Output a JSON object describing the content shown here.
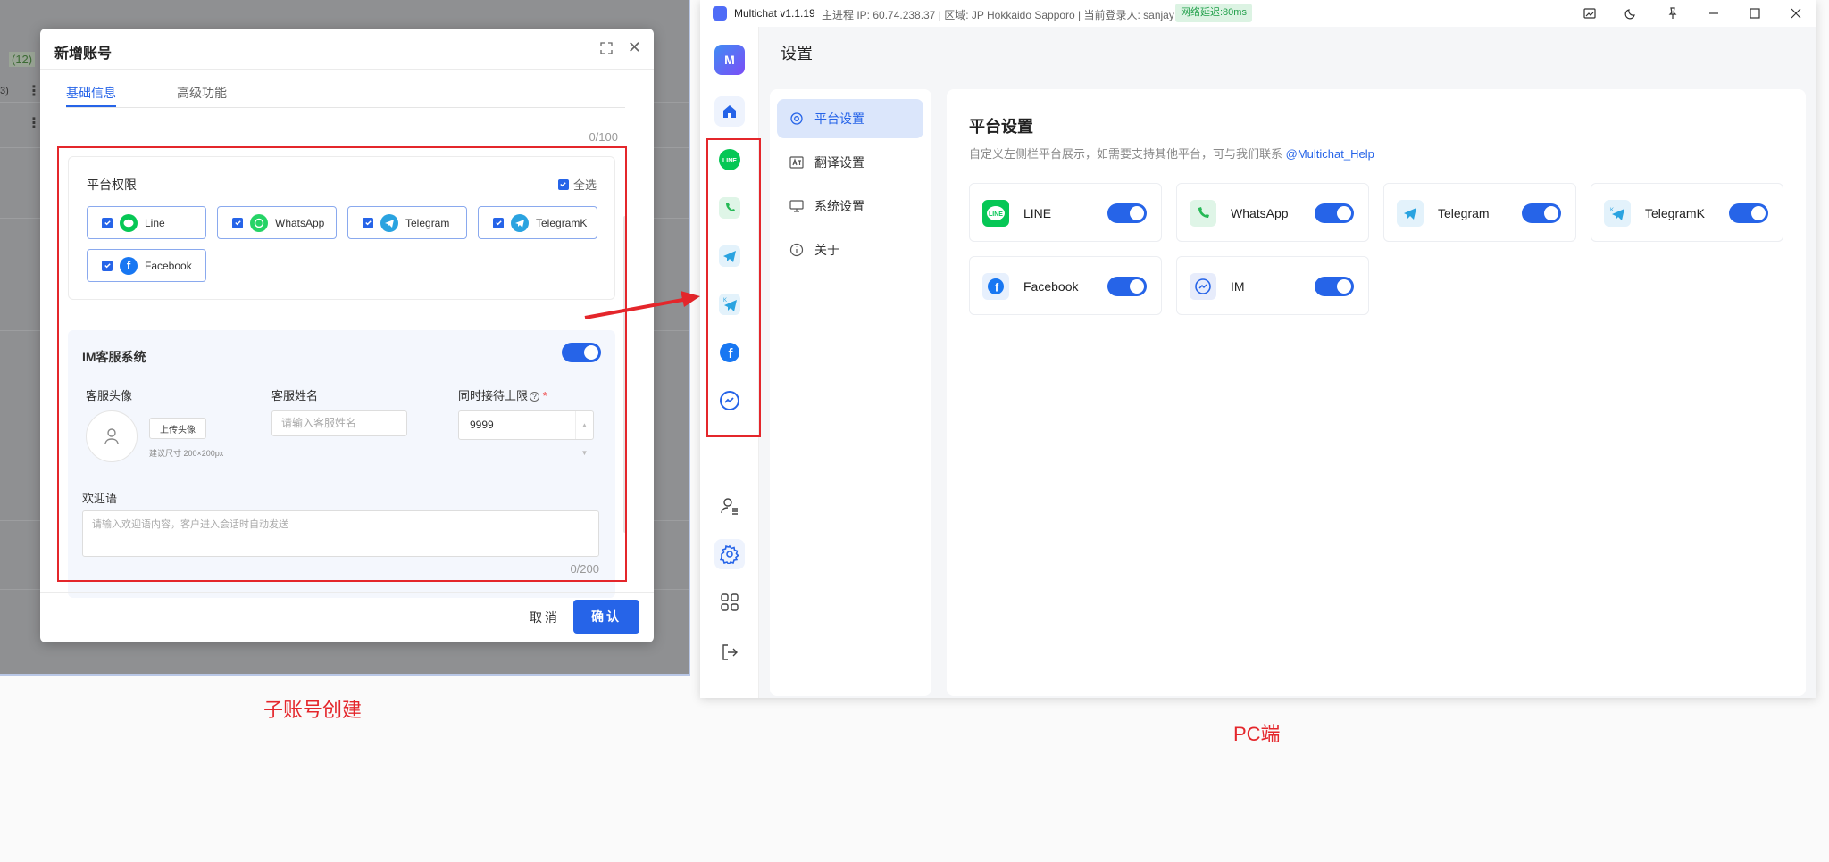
{
  "left": {
    "background": {
      "badge": "(12)",
      "small": "3)"
    },
    "modal": {
      "title": "新增账号",
      "tabs": [
        "基础信息",
        "高级功能"
      ],
      "counter_top": "0/100",
      "permissions": {
        "title": "平台权限",
        "select_all": "全选",
        "platforms": [
          {
            "label": "Line",
            "icon": "line-icon",
            "color": "#06c755"
          },
          {
            "label": "WhatsApp",
            "icon": "whatsapp-icon",
            "color": "#25d366"
          },
          {
            "label": "Telegram",
            "icon": "telegram-icon",
            "color": "#2aa3e0"
          },
          {
            "label": "TelegramK",
            "icon": "telegramk-icon",
            "color": "#2aa3e0"
          },
          {
            "label": "Facebook",
            "icon": "facebook-icon",
            "color": "#1877f2"
          }
        ]
      },
      "im": {
        "title": "IM客服系统",
        "avatar_label": "客服头像",
        "upload_button": "上传头像",
        "upload_hint": "建议尺寸 200×200px",
        "name_label": "客服姓名",
        "name_placeholder": "请输入客服姓名",
        "limit_label": "同时接待上限",
        "limit_value": "9999",
        "welcome_label": "欢迎语",
        "welcome_placeholder": "请输入欢迎语内容，客户进入会话时自动发送",
        "welcome_counter": "0/200"
      },
      "cancel": "取消",
      "confirm": "确认"
    },
    "caption": "子账号创建"
  },
  "app": {
    "titlebar": {
      "title": "Multichat v1.1.19",
      "info": "主进程 IP: 60.74.238.37 | 区域: JP Hokkaido Sapporo | 当前登录人: sanjay",
      "latency": "网络延迟:80ms"
    },
    "rail_logo": "M",
    "page_title": "设置",
    "nav": [
      {
        "label": "平台设置",
        "icon": "gear-icon",
        "active": true
      },
      {
        "label": "翻译设置",
        "icon": "translate-icon",
        "active": false
      },
      {
        "label": "系统设置",
        "icon": "monitor-icon",
        "active": false
      },
      {
        "label": "关于",
        "icon": "info-icon",
        "active": false
      }
    ],
    "main": {
      "title": "平台设置",
      "desc": "自定义左侧栏平台展示，如需要支持其他平台，可与我们联系",
      "link": "@Multichat_Help",
      "platforms": [
        {
          "name": "LINE",
          "icon": "line-icon",
          "enabled": true
        },
        {
          "name": "WhatsApp",
          "icon": "whatsapp-icon",
          "enabled": true
        },
        {
          "name": "Telegram",
          "icon": "telegram-icon",
          "enabled": true
        },
        {
          "name": "TelegramK",
          "icon": "telegramk-icon",
          "enabled": true
        },
        {
          "name": "Facebook",
          "icon": "facebook-icon",
          "enabled": true
        },
        {
          "name": "IM",
          "icon": "im-icon",
          "enabled": true
        }
      ]
    },
    "caption": "PC端"
  },
  "colors": {
    "accent": "#2664e8",
    "highlight": "#e4262b",
    "latency_bg": "#dcf3e3",
    "latency_text": "#22a04b"
  }
}
